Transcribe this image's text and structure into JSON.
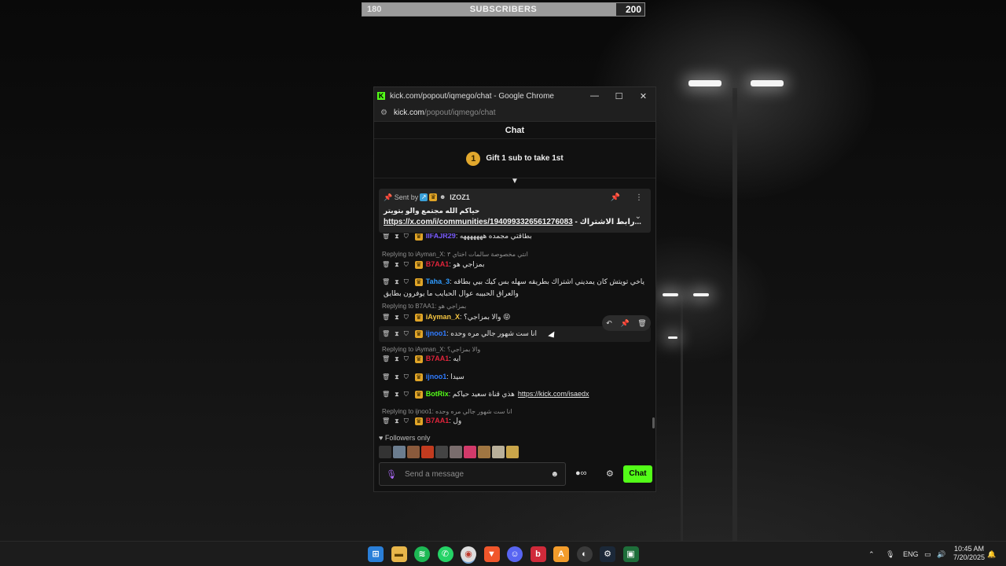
{
  "subscriber_goal": {
    "current": "180",
    "title": "SUBSCRIBERS",
    "target": "200",
    "progress": 0.9
  },
  "window": {
    "title": "kick.com/popout/iqmego/chat - Google Chrome",
    "url_host": "kick.com",
    "url_path": "/popout/iqmego/chat",
    "favicon": "K"
  },
  "chat": {
    "header": "Chat",
    "gift": {
      "rank": "1",
      "text": "Gift 1 sub to take 1st"
    },
    "pinned": {
      "sent_by_label": "Sent by",
      "username": "IZOZ1",
      "line1": "حياكم الله مجتمع والو بتويتر",
      "link": "https://x.com/i/communities/1940993326561276083",
      "line2_suffix": " - رابط الاشتراك..."
    },
    "messages": [
      {
        "type": "msg",
        "user": "IIFAJR29",
        "color": "#7a5cff",
        "text": "بطاقتي مجمده هههههههه",
        "partial": true
      },
      {
        "type": "reply",
        "text": "Replying to iAyman_X: انتي مخصوصة سالمات اختاي ٣"
      },
      {
        "type": "msg",
        "user": "B7AA1",
        "color": "#e0243a",
        "text": "بمزاجي هو"
      },
      {
        "type": "msg",
        "user": "Taha_3",
        "color": "#2f9bff",
        "text": "ياخي تويتش كان يمديني اشتراك بطريقه سهله بس كيك بيي بطاقه",
        "text2": "والعراق الحبيبه عوال الحبايب ما يوفرون بطايق"
      },
      {
        "type": "reply",
        "text": "Replying to B7AA1: بمزاجي هو"
      },
      {
        "type": "msg",
        "user": "iAyman_X",
        "color": "#f5c542",
        "text": "والا بمزاجي؟ 😝"
      },
      {
        "type": "msg",
        "user": "ijnoo1",
        "color": "#2f7bff",
        "text": "انا ست شهور جالي مره وحده"
      },
      {
        "type": "reply",
        "text": "Replying to iAyman_X: والا بمزاجي؟"
      },
      {
        "type": "msg",
        "user": "B7AA1",
        "color": "#e0243a",
        "text": "ايه"
      },
      {
        "type": "msg",
        "user": "ijnoo1",
        "color": "#2f7bff",
        "text": "سيدا"
      },
      {
        "type": "msg",
        "user": "BotRix",
        "color": "#53fc18",
        "text": "هذي قناة سعيد حياكم",
        "link": "https://kick.com/isaedx"
      },
      {
        "type": "reply",
        "text": "Replying to ijnoo1: انا ست شهور جالي مره وحده"
      },
      {
        "type": "msg",
        "user": "B7AA1",
        "color": "#e0243a",
        "text": "ول"
      }
    ],
    "followers_only_label": "Followers only",
    "composer_placeholder": "Send a message",
    "send_label": "Chat",
    "points_symbol": "∞"
  },
  "taskbar": {
    "apps": [
      "start-icon",
      "file-explorer-icon",
      "spotify-icon",
      "whatsapp-icon",
      "chrome-icon",
      "brave-icon",
      "discord-icon",
      "streamlabs-icon",
      "app-orange-icon",
      "obs-icon",
      "steam-icon",
      "terminal-icon"
    ],
    "language": "ENG",
    "time": "10:45 AM",
    "date": "7/20/2025"
  }
}
